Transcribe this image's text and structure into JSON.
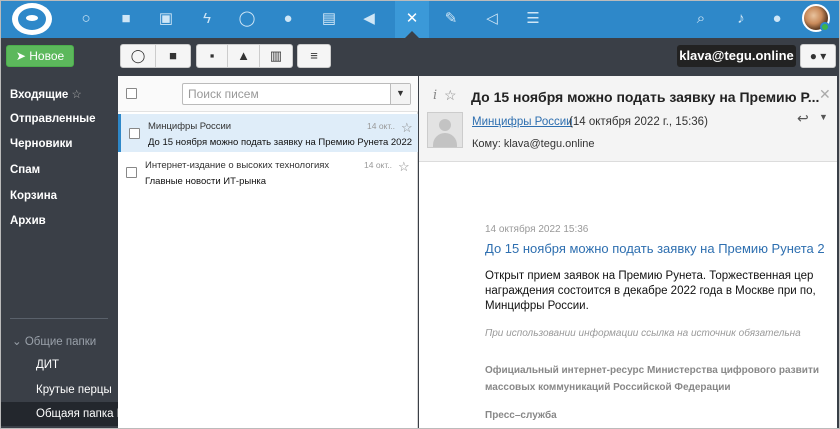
{
  "topbar": {
    "icons": [
      "logo",
      "circle-icon",
      "folder-icon",
      "image-icon",
      "bolt-icon",
      "chat-icon",
      "users-icon",
      "calendar-icon",
      "volume-icon",
      "network-icon",
      "edit-icon",
      "megaphone-icon",
      "list-icon",
      "search-icon",
      "bell-icon",
      "contacts-icon",
      "avatar"
    ],
    "active_icon": "network-icon",
    "accent": "#2e88c9"
  },
  "toolbar": {
    "new_label": "Новое",
    "account": "klava@tegu.online",
    "new_color": "#5cb85c"
  },
  "sidebar": {
    "folders": [
      "Входящие",
      "Отправленные",
      "Черновики",
      "Спам",
      "Корзина",
      "Архив"
    ],
    "group_label": "Общие папки",
    "shared": [
      "ДИТ",
      "Крутые перцы",
      "Общаяя папка M"
    ]
  },
  "list": {
    "search_placeholder": "Поиск писем",
    "messages": [
      {
        "sender": "Минцифры России",
        "date": "14 окт..",
        "subject": "До 15 ноября можно подать заявку на Премию Рунета 2022",
        "selected": true
      },
      {
        "sender": "Интернет-издание о высоких технологиях",
        "date": "14 окт..",
        "subject": "Главные новости ИТ-рынка",
        "selected": false
      }
    ]
  },
  "reader": {
    "subject": "До 15 ноября можно подать заявку на Премию Р...",
    "from": "Минцифры России",
    "date": "(14 октября 2022 г., 15:36)",
    "to": "Кому: klava@tegu.online",
    "body": {
      "date": "14 октября 2022 15:36",
      "title": "До 15 ноября можно подать заявку на Премию Рунета 2",
      "text1": "Открыт прием заявок на Премию Рунета. Торжественная цер",
      "text2": "награждения состоится в декабре 2022 года в Москве при по,",
      "text3": "Минцифры России.",
      "note": "При использовании информации ссылка на источник обязательна",
      "org1": "Официальный интернет-ресурс Министерства цифрового развити",
      "org2": "массовых коммуникаций Российской Федерации",
      "press": "Пресс–служба"
    }
  }
}
